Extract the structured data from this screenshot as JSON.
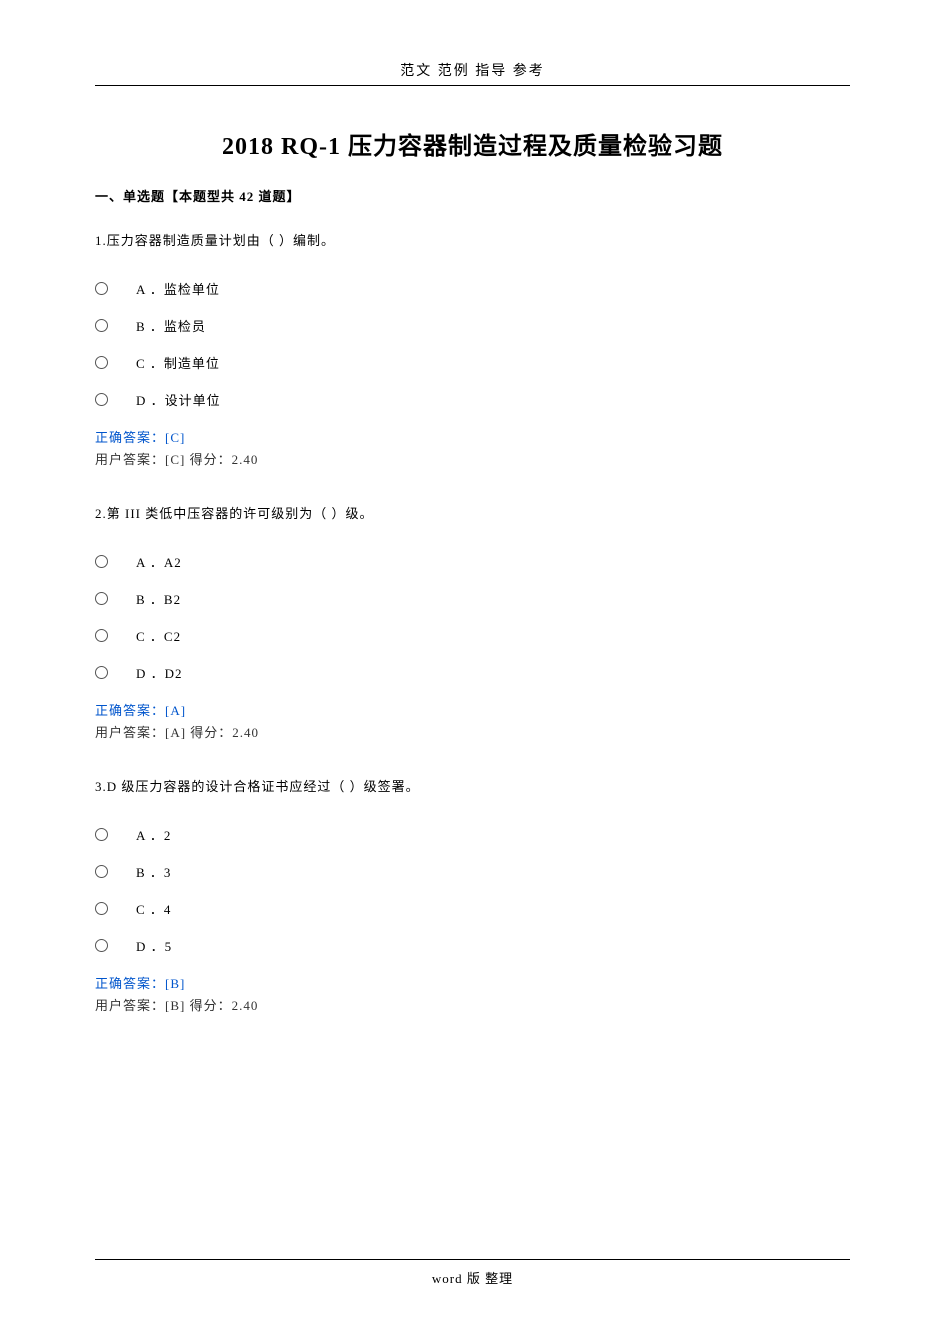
{
  "header": "范文 范例 指导  参考",
  "title": "2018 RQ-1 压力容器制造过程及质量检验习题",
  "section_header": "一、单选题【本题型共 42 道题】",
  "questions": [
    {
      "text": "1.压力容器制造质量计划由（  ）编制。",
      "options": [
        {
          "label": "A ．监检单位"
        },
        {
          "label": "B ．监检员"
        },
        {
          "label": "C ．制造单位"
        },
        {
          "label": "D ．设计单位"
        }
      ],
      "correct": "正确答案：[C]",
      "user": "用户答案：[C]   得分：2.40"
    },
    {
      "text": "2.第 III 类低中压容器的许可级别为（  ）级。",
      "options": [
        {
          "label": "A ．A2"
        },
        {
          "label": "B ．B2"
        },
        {
          "label": "C ．C2"
        },
        {
          "label": "D ．D2"
        }
      ],
      "correct": "正确答案：[A]",
      "user": "用户答案：[A]   得分：2.40"
    },
    {
      "text": "3.D 级压力容器的设计合格证书应经过（  ）级签署。",
      "options": [
        {
          "label": "A ．2"
        },
        {
          "label": "B ．3"
        },
        {
          "label": "C ．4"
        },
        {
          "label": "D ．5"
        }
      ],
      "correct": "正确答案：[B]",
      "user": "用户答案：[B]   得分：2.40"
    }
  ],
  "footer": "word 版 整理"
}
